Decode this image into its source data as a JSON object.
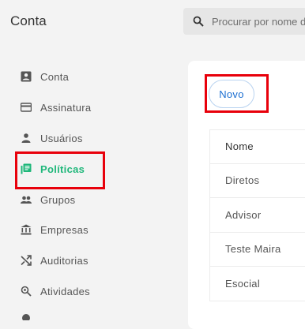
{
  "app": {
    "title": "Conta"
  },
  "search": {
    "placeholder": "Procurar por nome da"
  },
  "sidebar": {
    "items": [
      {
        "label": "Conta",
        "icon": "account-box-icon"
      },
      {
        "label": "Assinatura",
        "icon": "credit-card-icon"
      },
      {
        "label": "Usuários",
        "icon": "person-icon"
      },
      {
        "label": "Políticas",
        "icon": "library-books-icon",
        "active": true
      },
      {
        "label": "Grupos",
        "icon": "group-icon"
      },
      {
        "label": "Empresas",
        "icon": "bank-icon"
      },
      {
        "label": "Auditorias",
        "icon": "shuffle-icon"
      },
      {
        "label": "Atividades",
        "icon": "zoom-search-icon"
      }
    ]
  },
  "toolbar": {
    "new_label": "Novo"
  },
  "table": {
    "header": "Nome",
    "rows": [
      "Diretos",
      "Advisor",
      "Teste Maira",
      "Esocial"
    ]
  },
  "colors": {
    "accent": "#1fb77a",
    "highlight": "#e8000b",
    "link": "#1c6fd1"
  }
}
